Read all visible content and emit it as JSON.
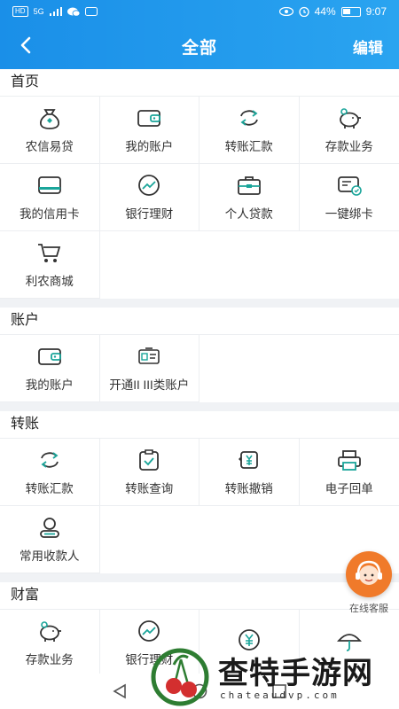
{
  "statusbar": {
    "left_badge": "HD",
    "signal": "5G",
    "battery": "44%",
    "time": "9:07"
  },
  "navbar": {
    "title": "全部",
    "edit_label": "编辑"
  },
  "sections": [
    {
      "title": "首页",
      "items": [
        {
          "label": "农信易贷",
          "icon": "money-bag-icon"
        },
        {
          "label": "我的账户",
          "icon": "wallet-icon"
        },
        {
          "label": "转账汇款",
          "icon": "transfer-icon"
        },
        {
          "label": "存款业务",
          "icon": "piggy-bank-icon"
        },
        {
          "label": "我的信用卡",
          "icon": "credit-card-icon"
        },
        {
          "label": "银行理财",
          "icon": "trend-chart-icon"
        },
        {
          "label": "个人贷款",
          "icon": "briefcase-icon"
        },
        {
          "label": "一键绑卡",
          "icon": "bind-card-icon"
        },
        {
          "label": "利农商城",
          "icon": "cart-icon"
        }
      ]
    },
    {
      "title": "账户",
      "items": [
        {
          "label": "我的账户",
          "icon": "wallet-icon"
        },
        {
          "label": "开通II III类账户",
          "icon": "id-card-icon"
        }
      ]
    },
    {
      "title": "转账",
      "items": [
        {
          "label": "转账汇款",
          "icon": "transfer-icon"
        },
        {
          "label": "转账查询",
          "icon": "clipboard-check-icon"
        },
        {
          "label": "转账撤销",
          "icon": "yuan-undo-icon"
        },
        {
          "label": "电子回单",
          "icon": "printer-icon"
        },
        {
          "label": "常用收款人",
          "icon": "contact-icon"
        }
      ]
    },
    {
      "title": "财富",
      "items": [
        {
          "label": "存款业务",
          "icon": "piggy-bank-icon"
        },
        {
          "label": "银行理财",
          "icon": "trend-chart-icon"
        },
        {
          "label": "",
          "icon": "yuan-coin-icon"
        },
        {
          "label": "",
          "icon": "umbrella-icon"
        }
      ]
    }
  ],
  "float_service": {
    "label": "在线客服"
  },
  "watermark": {
    "text": "查特手游网",
    "url": "chateaudvp.com"
  },
  "colors": {
    "accent": "#1a8fe8",
    "icon_teal": "#1aa59a",
    "icon_dark": "#333333",
    "service_orange": "#f07a2a"
  }
}
